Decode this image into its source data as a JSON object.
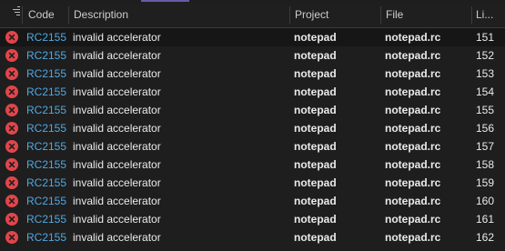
{
  "header": {
    "code": "Code",
    "description": "Description",
    "project": "Project",
    "file": "File",
    "line": "Li..."
  },
  "icons": {
    "filter": "filter-icon",
    "error": "error-icon",
    "error_color": "#e0464b"
  },
  "rows": [
    {
      "code": "RC2155",
      "description": "invalid accelerator",
      "project": "notepad",
      "file": "notepad.rc",
      "line": "151"
    },
    {
      "code": "RC2155",
      "description": "invalid accelerator",
      "project": "notepad",
      "file": "notepad.rc",
      "line": "152"
    },
    {
      "code": "RC2155",
      "description": "invalid accelerator",
      "project": "notepad",
      "file": "notepad.rc",
      "line": "153"
    },
    {
      "code": "RC2155",
      "description": "invalid accelerator",
      "project": "notepad",
      "file": "notepad.rc",
      "line": "154"
    },
    {
      "code": "RC2155",
      "description": "invalid accelerator",
      "project": "notepad",
      "file": "notepad.rc",
      "line": "155"
    },
    {
      "code": "RC2155",
      "description": "invalid accelerator",
      "project": "notepad",
      "file": "notepad.rc",
      "line": "156"
    },
    {
      "code": "RC2155",
      "description": "invalid accelerator",
      "project": "notepad",
      "file": "notepad.rc",
      "line": "157"
    },
    {
      "code": "RC2155",
      "description": "invalid accelerator",
      "project": "notepad",
      "file": "notepad.rc",
      "line": "158"
    },
    {
      "code": "RC2155",
      "description": "invalid accelerator",
      "project": "notepad",
      "file": "notepad.rc",
      "line": "159"
    },
    {
      "code": "RC2155",
      "description": "invalid accelerator",
      "project": "notepad",
      "file": "notepad.rc",
      "line": "160"
    },
    {
      "code": "RC2155",
      "description": "invalid accelerator",
      "project": "notepad",
      "file": "notepad.rc",
      "line": "161"
    },
    {
      "code": "RC2155",
      "description": "invalid accelerator",
      "project": "notepad",
      "file": "notepad.rc",
      "line": "162"
    }
  ]
}
